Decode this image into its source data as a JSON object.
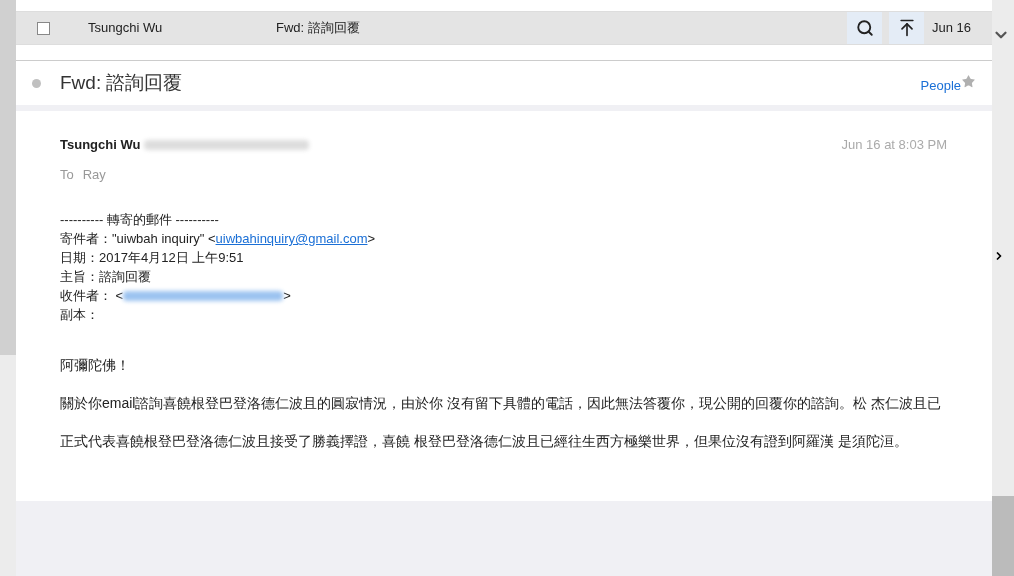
{
  "message_list": {
    "rows": [
      {
        "sender": "Tsungchi Wu",
        "subject": "Fwd: 諮詢回覆",
        "date": "Jun 16",
        "selected": true,
        "checked": false
      }
    ]
  },
  "reading_pane": {
    "subject": "Fwd: 諮詢回覆",
    "unread": false,
    "people_link": "People",
    "flagged": false,
    "from_name": "Tsungchi Wu",
    "timestamp": "Jun 16 at 8:03 PM",
    "to_label": "To",
    "to_name": "Ray",
    "forward_header": "---------- 轉寄的郵件 ----------",
    "forward_fields": [
      {
        "label": "寄件者：",
        "value": "\"uiwbah inquiry\" <",
        "link": "uiwbahinquiry@gmail.com",
        "after": ">",
        "blurred_link": false
      },
      {
        "label": "日期：",
        "value": "2017年4月12日 上午9:51"
      },
      {
        "label": "主旨：",
        "value": "諮詢回覆"
      },
      {
        "label": "收件者：",
        "value": " <",
        "blurred_link": true,
        "after": ">"
      },
      {
        "label": "副本："
      }
    ],
    "paragraphs": [
      "阿彌陀佛！",
      "關於你email諮詢喜饒根登巴登洛德仁波且的圓寂情況，由於你 沒有留下具體的電話，因此無法答覆你，現公開的回覆你的諮詢。松 杰仁波且已正式代表喜饒根登巴登洛德仁波且接受了勝義擇證，喜饒 根登巴登洛德仁波且已經往生西方極樂世界，但果位沒有證到阿羅漢 是須陀洹。"
    ]
  }
}
